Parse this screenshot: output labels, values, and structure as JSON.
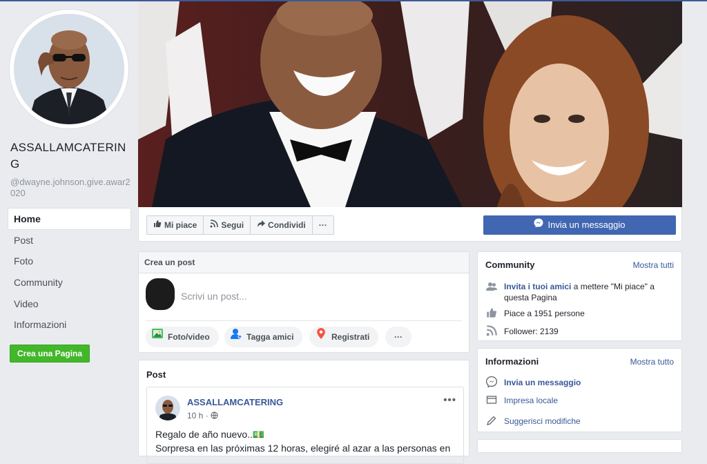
{
  "sidebar": {
    "page_name": "ASSALLAMCATERING",
    "handle": "@dwayne.johnson.give.awar2020",
    "nav": [
      "Home",
      "Post",
      "Foto",
      "Community",
      "Video",
      "Informazioni"
    ],
    "create_page_label": "Crea una Pagina"
  },
  "actions": {
    "like_label": "Mi piace",
    "follow_label": "Segui",
    "share_label": "Condividi",
    "more_label": "···",
    "message_label": "Invia un messaggio"
  },
  "composer": {
    "header": "Crea un post",
    "placeholder": "Scrivi un post...",
    "photo_label": "Foto/video",
    "tag_label": "Tagga amici",
    "checkin_label": "Registrati",
    "more_label": "···"
  },
  "posts": {
    "title": "Post",
    "author": "ASSALLAMCATERING",
    "time": "10 h ·",
    "text_line1": "Regalo de año nuevo..💵",
    "text_line2": "Sorpresa en las próximas 12 horas, elegiré al azar a las personas en"
  },
  "community": {
    "title": "Community",
    "link": "Mostra tutti",
    "invite_link": "Invita i tuoi amici",
    "invite_rest": " a mettere \"Mi piace\" a questa Pagina",
    "likes": "Piace a 1951 persone",
    "followers": "Follower: 2139"
  },
  "info": {
    "title": "Informazioni",
    "link": "Mostra tutto",
    "message": "Invia un messaggio",
    "business": "Impresa locale",
    "suggest": "Suggerisci modifiche"
  },
  "colors": {
    "brand": "#4267b2",
    "link": "#385898",
    "green": "#42b72a"
  }
}
